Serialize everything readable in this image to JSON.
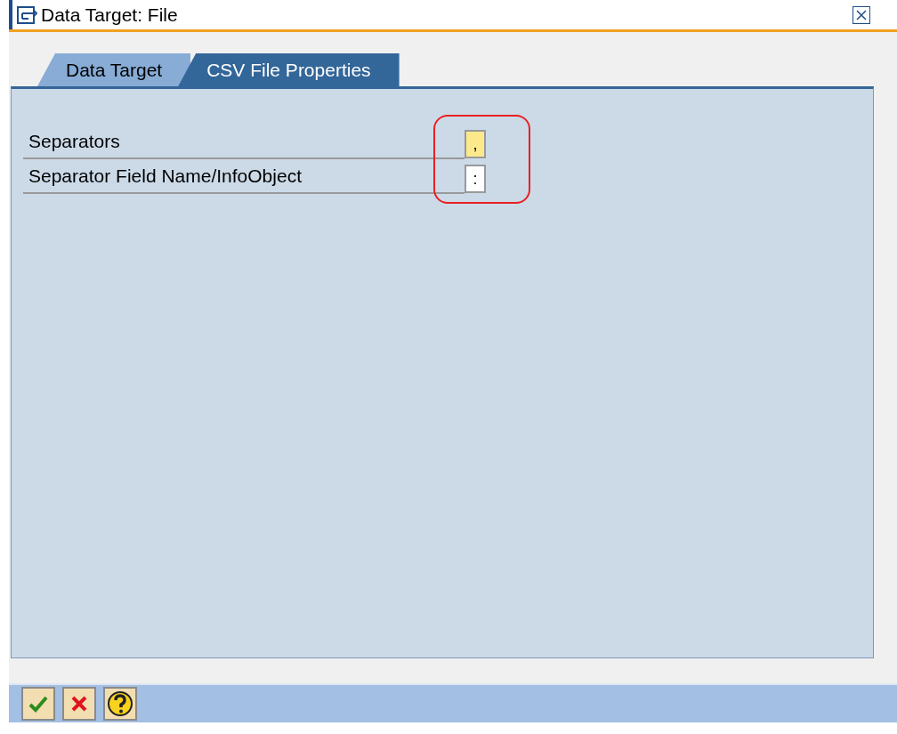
{
  "window": {
    "title": "Data Target: File"
  },
  "tabs": [
    {
      "label": "Data Target",
      "selected": false
    },
    {
      "label": "CSV File Properties",
      "selected": true
    }
  ],
  "fields": [
    {
      "label": "Separators",
      "value": ",",
      "focused": true
    },
    {
      "label": "Separator Field Name/InfoObject",
      "value": ":",
      "focused": false
    }
  ],
  "buttons": [
    {
      "kind": "confirm"
    },
    {
      "kind": "cancel"
    },
    {
      "kind": "help"
    }
  ]
}
